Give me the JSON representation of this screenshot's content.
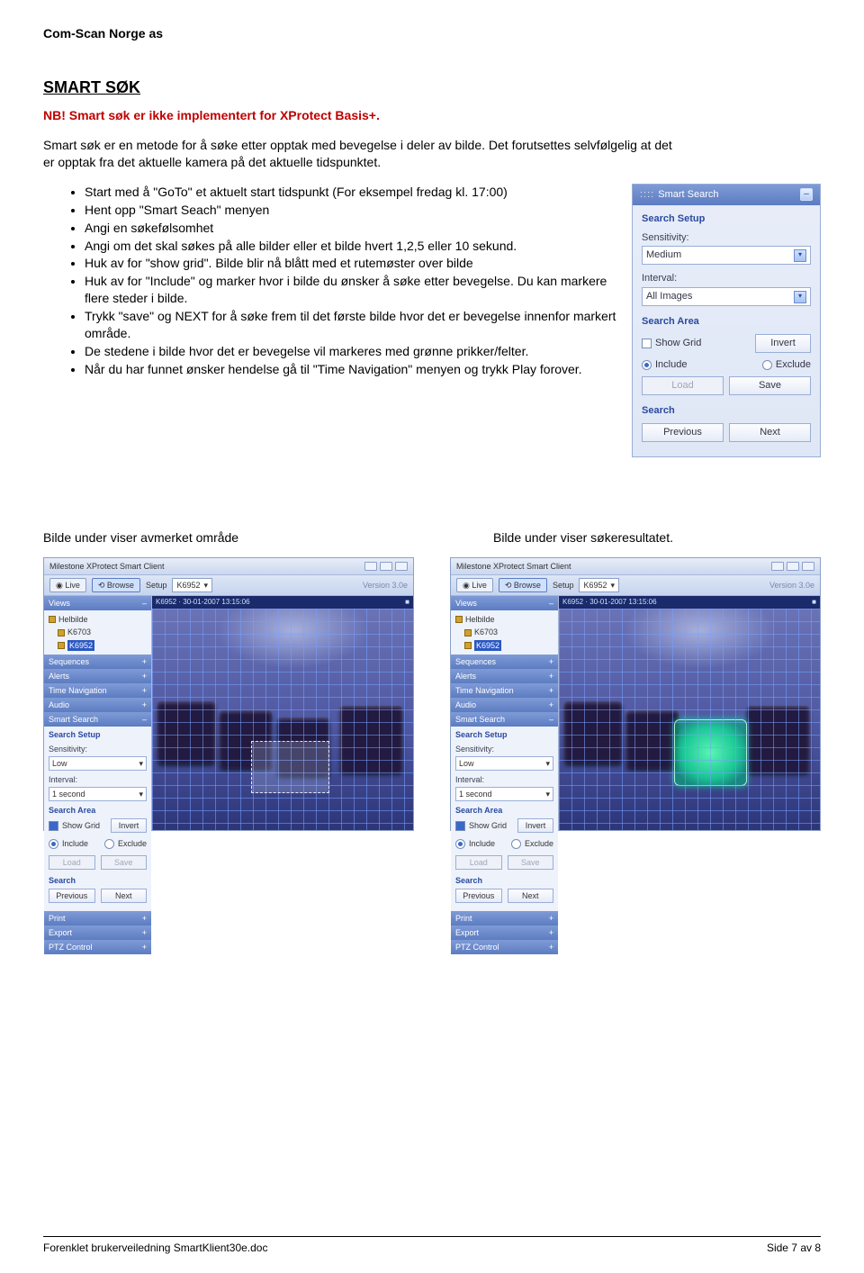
{
  "company": "Com-Scan Norge as",
  "section_title": "SMART SØK",
  "nb": "NB! Smart søk er ikke implementert for XProtect Basis+.",
  "intro": "Smart søk er en metode for å søke etter opptak med bevegelse i deler av bilde. Det forutsettes selvfølgelig at det er opptak fra det aktuelle kamera på det aktuelle tidspunktet.",
  "bullets": [
    "Start med å \"GoTo\" et aktuelt start tidspunkt (For eksempel fredag kl. 17:00)",
    "Hent opp \"Smart Seach\" menyen",
    "Angi en søkefølsomhet",
    "Angi om det skal søkes på alle bilder eller et bilde hvert 1,2,5 eller 10 sekund.",
    "Huk av for \"show grid\". Bilde blir nå blått med et rutemøster over bilde",
    "Huk av for \"Include\" og marker hvor i bilde du ønsker å søke etter bevegelse. Du kan markere flere  steder i bilde.",
    "Trykk \"save\" og NEXT for å søke frem til det første bilde hvor det er bevegelse innenfor markert område.",
    "De stedene i bilde hvor det er bevegelse vil markeres med grønne prikker/felter.",
    "Når du har funnet ønsker hendelse gå til \"Time Navigation\" menyen og trykk Play forover."
  ],
  "panel": {
    "title": "Smart Search",
    "setup": "Search Setup",
    "sensitivity_lbl": "Sensitivity:",
    "sensitivity_val": "Medium",
    "interval_lbl": "Interval:",
    "interval_val": "All Images",
    "area": "Search Area",
    "show_grid": "Show Grid",
    "invert": "Invert",
    "include": "Include",
    "exclude": "Exclude",
    "load": "Load",
    "save": "Save",
    "search": "Search",
    "previous": "Previous",
    "next": "Next"
  },
  "caption_left": "Bilde under viser avmerket område",
  "caption_right": "Bilde under viser søkeresultatet.",
  "client": {
    "title": "Milestone XProtect Smart Client",
    "live": "Live",
    "browse": "Browse",
    "setup_label": "Setup",
    "setup_value": "K6952",
    "version": "Version 3.0e",
    "views": "Views",
    "sequences": "Sequences",
    "alerts": "Alerts",
    "time_nav": "Time Navigation",
    "audio": "Audio",
    "smart_search": "Smart Search",
    "print": "Print",
    "export": "Export",
    "ptz": "PTZ Control",
    "tree_root": "Helbilde",
    "tree_cam1": "K6703",
    "tree_cam2": "K6952",
    "panel_setup": "Search Setup",
    "panel_sens_lbl": "Sensitivity:",
    "panel_sens_val": "Low",
    "panel_int_lbl": "Interval:",
    "panel_int_val": "1 second",
    "panel_area": "Search Area",
    "panel_showgrid": "Show Grid",
    "panel_invert": "Invert",
    "panel_include": "Include",
    "panel_exclude": "Exclude",
    "panel_load": "Load",
    "panel_save": "Save",
    "panel_search": "Search",
    "panel_prev": "Previous",
    "panel_next": "Next",
    "vp_stamp": "K6952 · 30-01-2007 13:15:06"
  },
  "footer_left": "Forenklet brukerveiledning SmartKlient30e.doc",
  "footer_right": "Side 7 av 8"
}
